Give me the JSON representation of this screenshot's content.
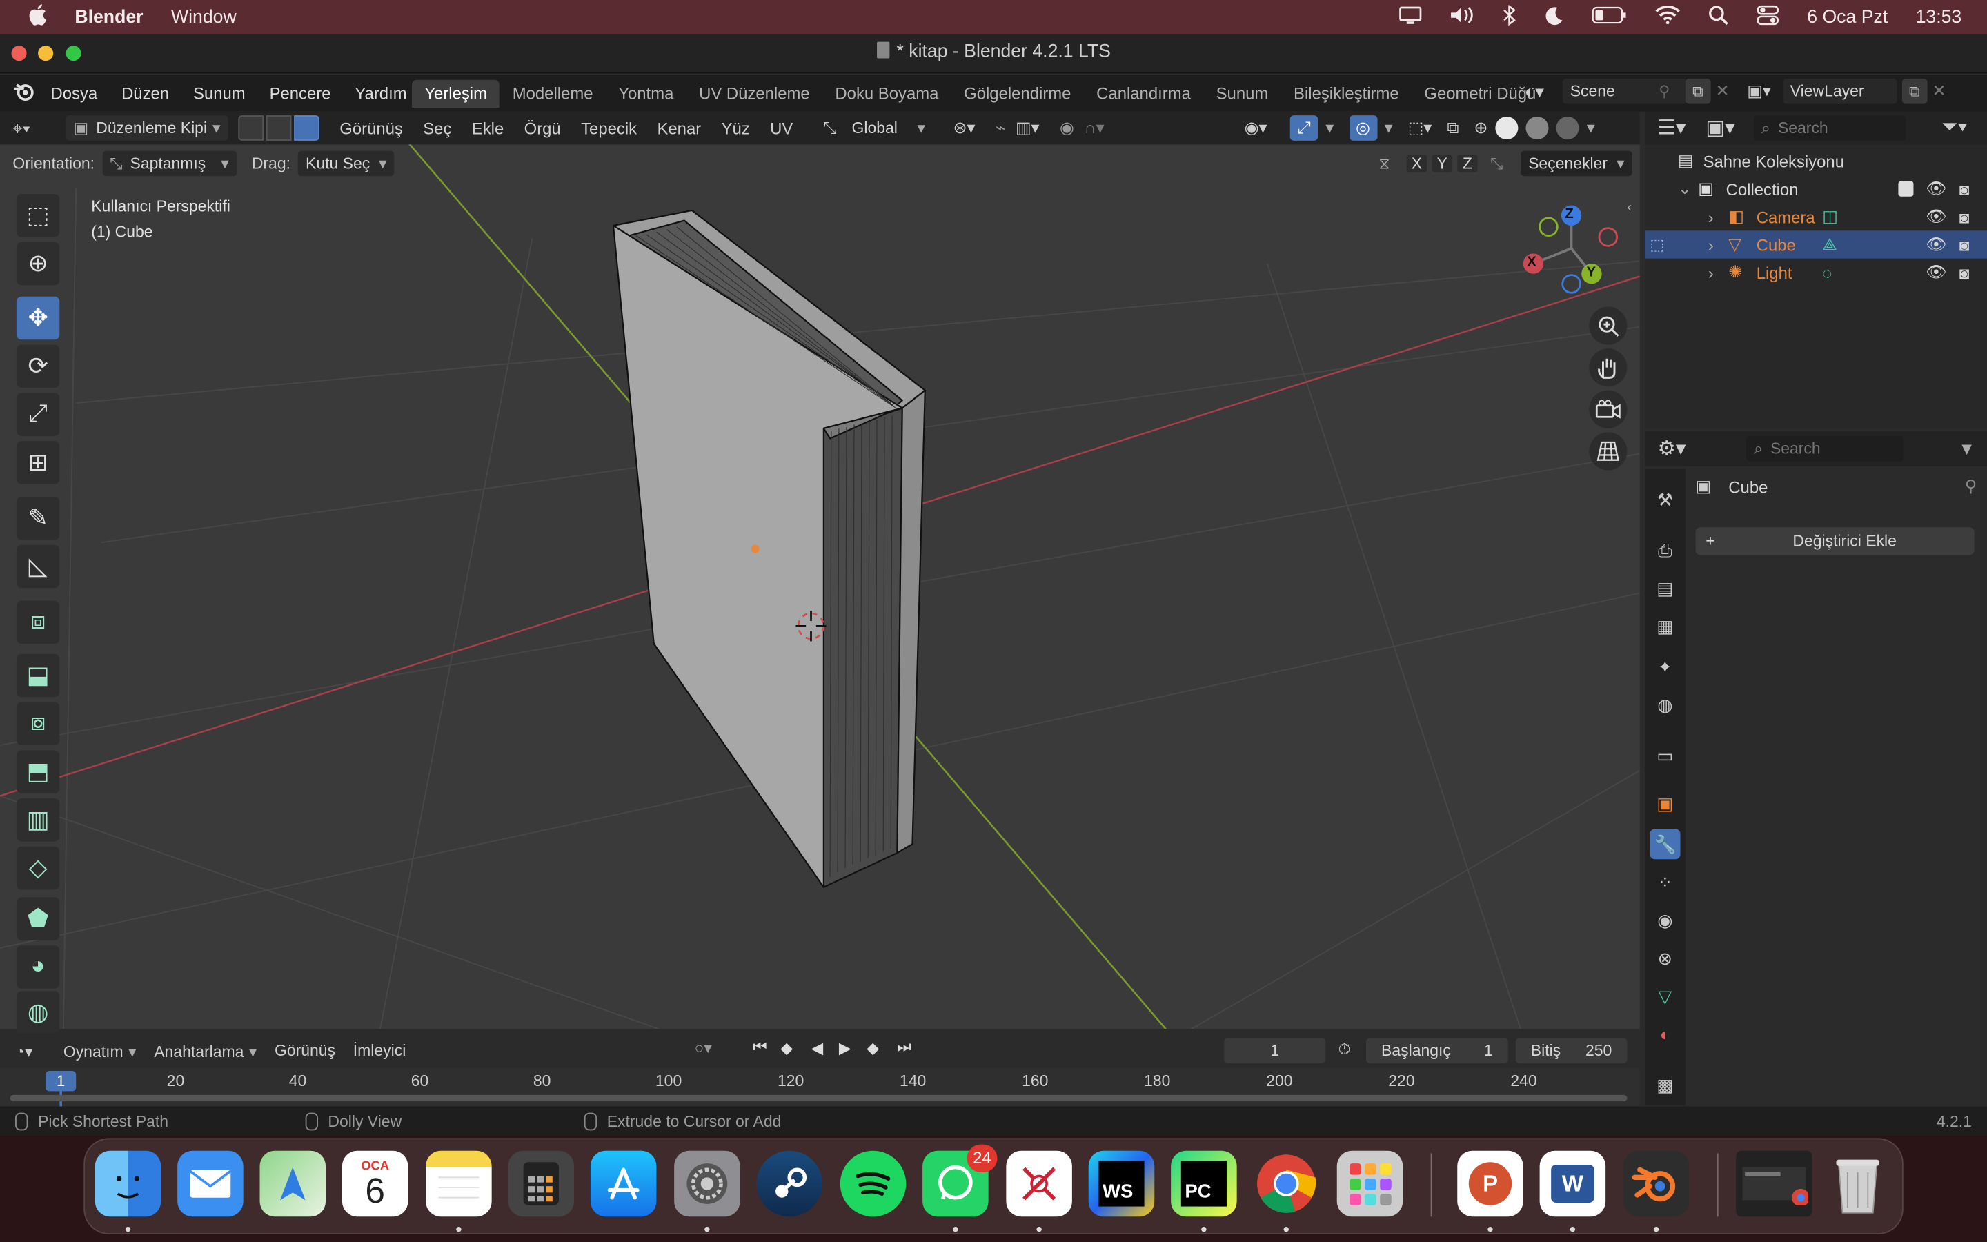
{
  "mac_menu": {
    "apple": "",
    "app": "Blender",
    "window": "Window",
    "date": "6 Oca Pzt",
    "time": "13:53"
  },
  "window": {
    "title": "* kitap - Blender 4.2.1 LTS"
  },
  "topbar": {
    "menus": [
      "Dosya",
      "Düzen",
      "Sunum",
      "Pencere",
      "Yardım"
    ],
    "workspaces": [
      "Yerleşim",
      "Modelleme",
      "Yontma",
      "UV Düzenleme",
      "Doku Boyama",
      "Gölgelendirme",
      "Canlandırma",
      "Sunum",
      "Bileşikleştirme",
      "Geometri Düğü"
    ],
    "active_workspace": 0,
    "scene": "Scene",
    "view_layer": "ViewLayer"
  },
  "viewport_header": {
    "mode": "Düzenleme Kipi",
    "menus": [
      "Görünüş",
      "Seç",
      "Ekle",
      "Örgü",
      "Tepecik",
      "Kenar",
      "Yüz",
      "UV"
    ],
    "transform_orientation": "Global"
  },
  "tool_options": {
    "orientation_label": "Orientation:",
    "orientation_value": "Saptanmış",
    "drag_label": "Drag:",
    "drag_value": "Kutu Seç",
    "axes": [
      "X",
      "Y",
      "Z"
    ],
    "options": "Seçenekler"
  },
  "viewport": {
    "view_name": "Kullanıcı Perspektifi",
    "object_label": "(1) Cube",
    "gizmo": {
      "x": "X",
      "y": "Y",
      "z": "Z"
    }
  },
  "outliner": {
    "search_placeholder": "Search",
    "scene_collection": "Sahne Koleksiyonu",
    "collection": "Collection",
    "items": [
      {
        "name": "Camera",
        "color": "#e8873a",
        "selected": false
      },
      {
        "name": "Cube",
        "color": "#e8873a",
        "selected": true
      },
      {
        "name": "Light",
        "color": "#e8873a",
        "selected": false
      }
    ]
  },
  "properties": {
    "search_placeholder": "Search",
    "object_name": "Cube",
    "add_modifier": "Değiştirici Ekle"
  },
  "timeline": {
    "menus": [
      "Oynatım",
      "Anahtarlama",
      "Görünüş",
      "İmleyici"
    ],
    "current_frame": "1",
    "start_label": "Başlangıç",
    "start": "1",
    "end_label": "Bitiş",
    "end": "250",
    "ruler": [
      "20",
      "40",
      "60",
      "80",
      "100",
      "120",
      "140",
      "160",
      "180",
      "200",
      "220",
      "240"
    ],
    "cursor_frame": "1"
  },
  "statusbar": {
    "hint1": "Pick Shortest Path",
    "hint2": "Dolly View",
    "hint3": "Extrude to Cursor or Add",
    "version": "4.2.1"
  },
  "dock": {
    "calendar_month": "OCA",
    "calendar_day": "6",
    "whatsapp_badge": "24",
    "apps": [
      "finder",
      "mail",
      "maps",
      "calendar",
      "notes",
      "calculator",
      "app-store",
      "system-settings",
      "steam",
      "spotify",
      "whatsapp",
      "kcs",
      "webstorm",
      "pycharm",
      "chrome",
      "launchpad",
      "powerpoint",
      "word",
      "blender",
      "window-preview",
      "trash"
    ],
    "ws_label": "WS",
    "pc_label": "PC",
    "ppt_label": "P",
    "word_label": "W"
  },
  "colors": {
    "accent": "#4772b3",
    "x_axis": "#c94a52",
    "y_axis": "#88b42c",
    "z_axis": "#3b7be0",
    "origin": "#e8873a"
  }
}
